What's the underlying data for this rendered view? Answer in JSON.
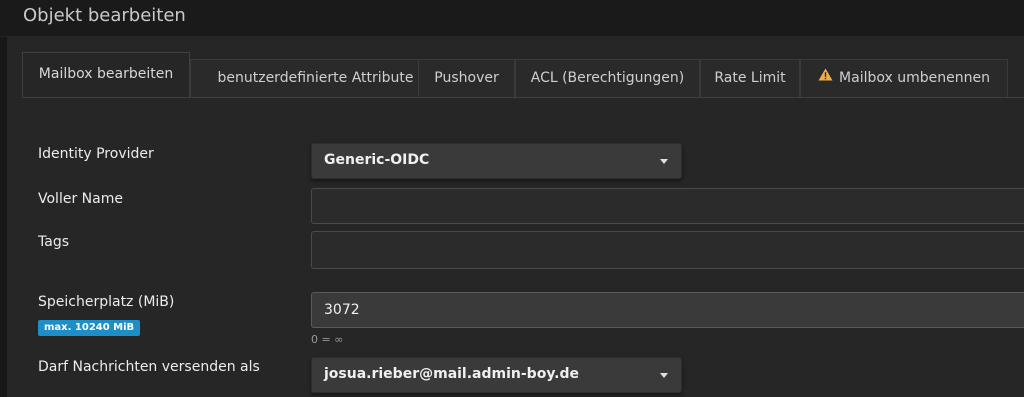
{
  "header": {
    "title": "Objekt bearbeiten"
  },
  "tabs": [
    {
      "label": "Mailbox bearbeiten",
      "active": true
    },
    {
      "label": "benutzerdefinierte Attribute",
      "active": false
    },
    {
      "label": "Pushover",
      "active": false
    },
    {
      "label": "ACL (Berechtigungen)",
      "active": false
    },
    {
      "label": "Rate Limit",
      "active": false
    },
    {
      "label": "Mailbox umbenennen",
      "active": false,
      "icon": "warning-icon"
    }
  ],
  "form": {
    "identity_provider": {
      "label": "Identity Provider",
      "value": "Generic-OIDC"
    },
    "full_name": {
      "label": "Voller Name",
      "value": ""
    },
    "tags": {
      "label": "Tags",
      "value": ""
    },
    "quota": {
      "label": "Speicherplatz (MiB)",
      "value": "3072",
      "badge": "max. 10240 MiB",
      "hint": "0 = ∞"
    },
    "send_as": {
      "label": "Darf Nachrichten versenden als",
      "value": "josua.rieber@mail.admin-boy.de"
    }
  },
  "colors": {
    "badge": "#1e8fc6",
    "warning": "#f0ad4e"
  }
}
